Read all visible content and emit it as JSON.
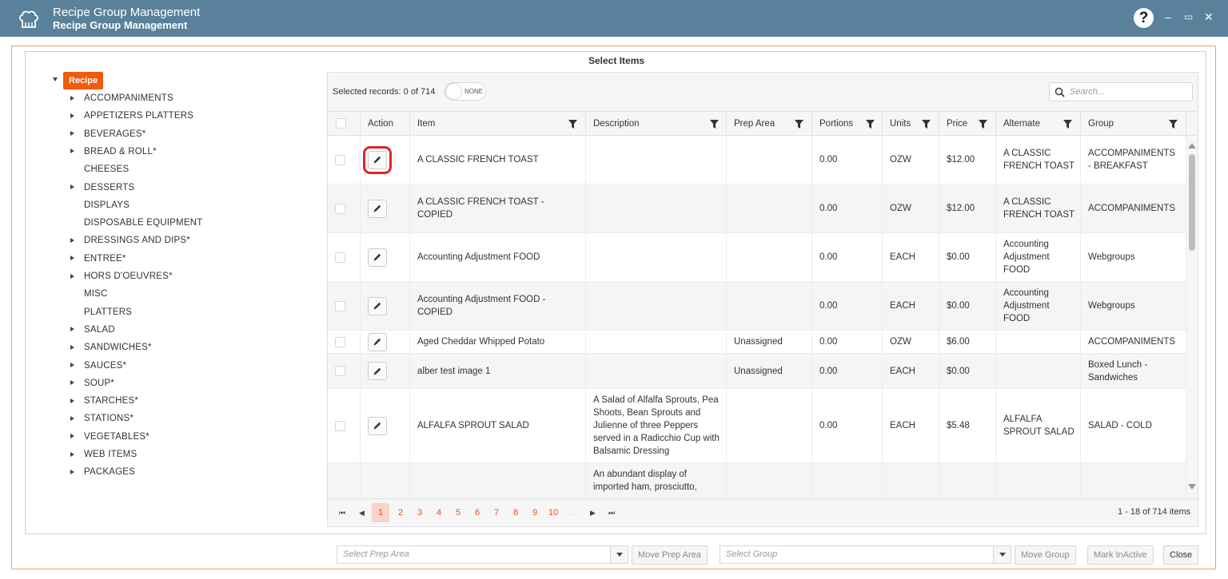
{
  "window": {
    "title": "Recipe Group Management",
    "subtitle": "Recipe Group Management",
    "help_label": "?",
    "minimize_label": "–",
    "maximize_label": "▭",
    "close_label": "✕"
  },
  "section_title": "Select Items",
  "tree": {
    "root": "Recipe",
    "items": [
      {
        "label": "ACCOMPANIMENTS",
        "expandable": true
      },
      {
        "label": "APPETIZERS PLATTERS",
        "expandable": true
      },
      {
        "label": "BEVERAGES*",
        "expandable": true
      },
      {
        "label": "BREAD & ROLL*",
        "expandable": true
      },
      {
        "label": "CHEESES",
        "expandable": false
      },
      {
        "label": "DESSERTS",
        "expandable": true
      },
      {
        "label": "DISPLAYS",
        "expandable": false
      },
      {
        "label": "DISPOSABLE EQUIPMENT",
        "expandable": false
      },
      {
        "label": "DRESSINGS AND DIPS*",
        "expandable": true
      },
      {
        "label": "ENTREE*",
        "expandable": true
      },
      {
        "label": "HORS D'OEUVRES*",
        "expandable": true
      },
      {
        "label": "MISC",
        "expandable": false
      },
      {
        "label": "PLATTERS",
        "expandable": false
      },
      {
        "label": "SALAD",
        "expandable": true
      },
      {
        "label": "SANDWICHES*",
        "expandable": true
      },
      {
        "label": "SAUCES*",
        "expandable": true
      },
      {
        "label": "SOUP*",
        "expandable": true
      },
      {
        "label": "STARCHES*",
        "expandable": true
      },
      {
        "label": "STATIONS*",
        "expandable": true
      },
      {
        "label": "VEGETABLES*",
        "expandable": true
      },
      {
        "label": "WEB ITEMS",
        "expandable": true
      },
      {
        "label": "PACKAGES",
        "expandable": true
      }
    ]
  },
  "grid": {
    "selected_text": "Selected records: 0 of 714",
    "toggle_label": "NONE",
    "search_placeholder": "Search...",
    "columns": [
      "Action",
      "Item",
      "Description",
      "Prep Area",
      "Portions",
      "Units",
      "Price",
      "Alternate",
      "Group"
    ],
    "rows": [
      {
        "item": "A CLASSIC FRENCH TOAST",
        "description": "",
        "prep": "",
        "portions": "0.00",
        "units": "OZW",
        "price": "$12.00",
        "alternate": "A CLASSIC FRENCH TOAST",
        "group": "ACCOMPANIMENTS - BREAKFAST"
      },
      {
        "item": "A CLASSIC FRENCH TOAST - COPIED",
        "description": "",
        "prep": "",
        "portions": "0.00",
        "units": "OZW",
        "price": "$12.00",
        "alternate": "A CLASSIC FRENCH TOAST",
        "group": "ACCOMPANIMENTS"
      },
      {
        "item": "Accounting Adjustment FOOD",
        "description": "",
        "prep": "",
        "portions": "0.00",
        "units": "EACH",
        "price": "$0.00",
        "alternate": "Accounting Adjustment FOOD",
        "group": "Webgroups"
      },
      {
        "item": "Accounting Adjustment FOOD - COPIED",
        "description": "",
        "prep": "",
        "portions": "0.00",
        "units": "EACH",
        "price": "$0.00",
        "alternate": "Accounting Adjustment FOOD",
        "group": "Webgroups"
      },
      {
        "item": "Aged Cheddar Whipped Potato",
        "description": "",
        "prep": "Unassigned",
        "portions": "0.00",
        "units": "OZW",
        "price": "$6.00",
        "alternate": "",
        "group": "ACCOMPANIMENTS"
      },
      {
        "item": "alber test image 1",
        "description": "",
        "prep": "Unassigned",
        "portions": "0.00",
        "units": "EACH",
        "price": "$0.00",
        "alternate": "",
        "group": "Boxed Lunch - Sandwiches"
      },
      {
        "item": "ALFALFA SPROUT SALAD",
        "description": "A Salad of Alfalfa Sprouts, Pea Shoots, Bean Sprouts and Julienne of three Peppers served in a Radicchio Cup with Balsamic Dressing",
        "prep": "",
        "portions": "0.00",
        "units": "EACH",
        "price": "$5.48",
        "alternate": "ALFALFA SPROUT SALAD",
        "group": "SALAD - COLD"
      },
      {
        "item": "",
        "description": "An abundant display of imported ham, prosciutto,",
        "prep": "",
        "portions": "",
        "units": "",
        "price": "",
        "alternate": "",
        "group": ""
      }
    ]
  },
  "pager": {
    "pages": [
      "1",
      "2",
      "3",
      "4",
      "5",
      "6",
      "7",
      "8",
      "9",
      "10",
      "..."
    ],
    "current_page": "1",
    "info": "1 - 18 of 714 items",
    "first": "⏮",
    "prev": "◀",
    "next": "▶",
    "last": "⏭"
  },
  "footer": {
    "prep_placeholder": "Select Prep Area",
    "move_prep": "Move Prep Area",
    "group_placeholder": "Select Group",
    "move_group": "Move Group",
    "mark_inactive": "Mark InActive",
    "close": "Close"
  }
}
